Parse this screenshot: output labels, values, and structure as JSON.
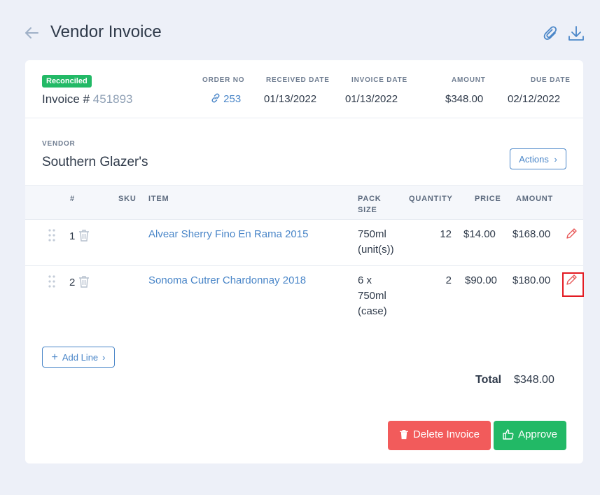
{
  "header": {
    "title": "Vendor Invoice",
    "back_icon": "arrow-left-icon",
    "attach_icon": "paperclip-icon",
    "download_icon": "download-icon"
  },
  "invoice": {
    "status_badge": "Reconciled",
    "invoice_prefix": "Invoice #",
    "invoice_number": "451893",
    "order_no_label": "ORDER NO",
    "order_no": "253",
    "received_date_label": "RECEIVED DATE",
    "received_date": "01/13/2022",
    "invoice_date_label": "INVOICE DATE",
    "invoice_date": "01/13/2022",
    "amount_label": "AMOUNT",
    "amount": "$348.00",
    "due_date_label": "DUE DATE",
    "due_date": "02/12/2022"
  },
  "vendor": {
    "label": "VENDOR",
    "name": "Southern Glazer's",
    "actions_label": "Actions"
  },
  "table": {
    "columns": {
      "num": "#",
      "sku": "SKU",
      "item": "ITEM",
      "pack_size_1": "PACK",
      "pack_size_2": "SIZE",
      "quantity": "QUANTITY",
      "price": "PRICE",
      "amount": "AMOUNT"
    },
    "rows": [
      {
        "num": "1",
        "sku": "",
        "item": "Alvear Sherry Fino En Rama 2015",
        "pack_line_1": "750ml",
        "pack_line_2": "(unit(s))",
        "pack_line_3": "",
        "quantity": "12",
        "price": "$14.00",
        "amount": "$168.00"
      },
      {
        "num": "2",
        "sku": "",
        "item": "Sonoma Cutrer Chardonnay 2018",
        "pack_line_1": "6 x",
        "pack_line_2": "750ml",
        "pack_line_3": "(case)",
        "quantity": "2",
        "price": "$90.00",
        "amount": "$180.00"
      }
    ]
  },
  "footer": {
    "add_line_label": "Add Line",
    "total_label": "Total",
    "total_value": "$348.00",
    "delete_label": "Delete Invoice",
    "approve_label": "Approve"
  },
  "colors": {
    "background": "#edf0f8",
    "accent_blue": "#4a86c8",
    "success_green": "#22b966",
    "danger_red": "#f25b5b",
    "highlight_red": "#e31b23"
  }
}
